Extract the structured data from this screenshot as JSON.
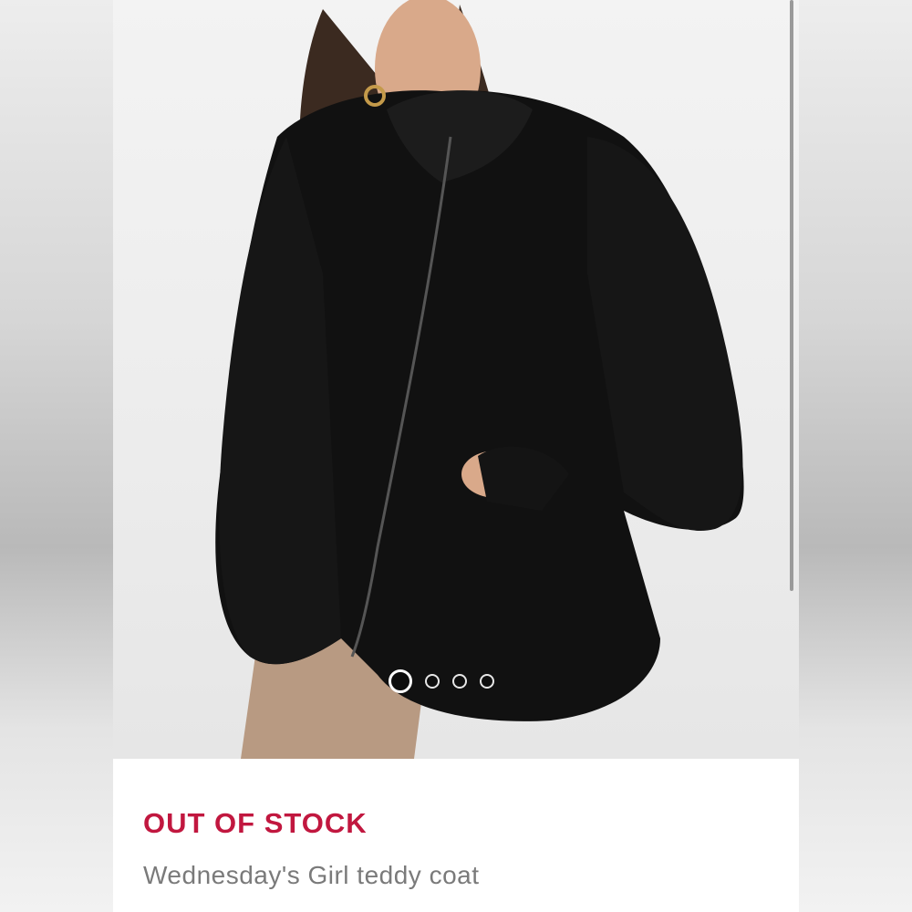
{
  "product": {
    "image_alt": "Model wearing black teddy coat",
    "status": "OUT OF STOCK",
    "title": "Wednesday's Girl teddy coat"
  },
  "carousel": {
    "total_slides": 4,
    "active_index": 0
  },
  "colors": {
    "status": "#c1173f",
    "title": "#7a7a7a",
    "coat": "#111111"
  }
}
